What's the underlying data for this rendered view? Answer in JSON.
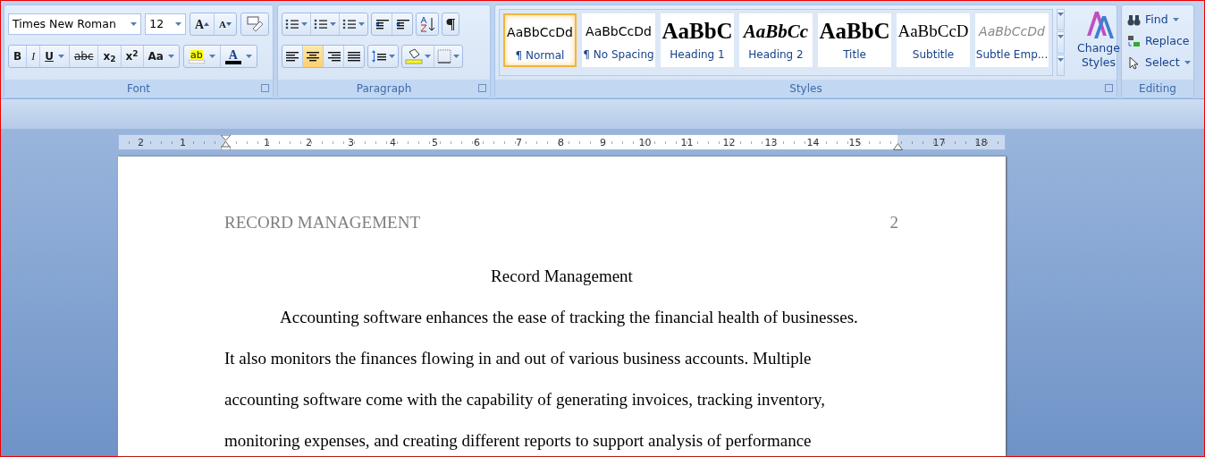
{
  "ribbon": {
    "font": {
      "label": "Font",
      "font_name": "Times New Roman",
      "font_size": "12",
      "size_buttons": [
        {
          "label": "A"
        },
        {
          "label": "A"
        }
      ],
      "format_buttons": [
        {
          "label": "B",
          "kind": "bold",
          "dropdown": false
        },
        {
          "label": "I",
          "kind": "italic",
          "dropdown": false
        },
        {
          "label": "U",
          "kind": "underline",
          "dropdown": true
        },
        {
          "label": "abc",
          "kind": "strike",
          "dropdown": false
        },
        {
          "label": "x$_{2}$",
          "kind": "plain",
          "dropdown": false
        },
        {
          "label": "x$^{2}$",
          "kind": "plain",
          "dropdown": false
        },
        {
          "label": "Aa",
          "kind": "plain",
          "dropdown": true
        }
      ],
      "highlight_label": "ab",
      "color_label": "A"
    },
    "paragraph": {
      "label": "Paragraph",
      "alignment_buttons": [
        {
          "selected": false
        },
        {
          "selected": true
        },
        {
          "selected": false
        },
        {
          "selected": false
        }
      ]
    },
    "styles": {
      "label": "Styles",
      "items": [
        {
          "preview": "AaBbCcDd",
          "label": "¶ Normal",
          "kind": "normal",
          "selected": true
        },
        {
          "preview": "AaBbCcDd",
          "label": "¶ No Spacing",
          "kind": "normal",
          "selected": false
        },
        {
          "preview": "AaBbC",
          "label": "Heading 1",
          "kind": "heading1",
          "selected": false
        },
        {
          "preview": "AaBbCc",
          "label": "Heading 2",
          "kind": "heading2",
          "selected": false
        },
        {
          "preview": "AaBbC",
          "label": "Title",
          "kind": "title",
          "selected": false
        },
        {
          "preview": "AaBbCcD",
          "label": "Subtitle",
          "kind": "subtitle",
          "selected": false
        },
        {
          "preview": "AaBbCcDd",
          "label": "Subtle Emp...",
          "kind": "subtle",
          "selected": false
        }
      ],
      "change_styles": "Change Styles"
    },
    "editing": {
      "label": "Editing",
      "items": [
        {
          "label": "Find",
          "dropdown": true
        },
        {
          "label": "Replace",
          "dropdown": false
        },
        {
          "label": "Select",
          "dropdown": true
        }
      ]
    }
  },
  "ruler": {
    "left_labels": [
      "2",
      "1"
    ],
    "labels": [
      "1",
      "2",
      "3",
      "4",
      "5",
      "6",
      "7",
      "8",
      "9",
      "10",
      "11",
      "12",
      "13",
      "14",
      "15"
    ],
    "right_labels": [
      "17",
      "18"
    ]
  },
  "document": {
    "header": "RECORD MANAGEMENT",
    "page_number": "2",
    "title": "Record Management",
    "lines": [
      "Accounting software enhances the ease of tracking the financial health of businesses.",
      "It also monitors the finances flowing in and out of various business accounts. Multiple",
      "accounting software come with the capability of generating invoices, tracking inventory,",
      "monitoring expenses, and creating different reports to support analysis of performance"
    ]
  }
}
